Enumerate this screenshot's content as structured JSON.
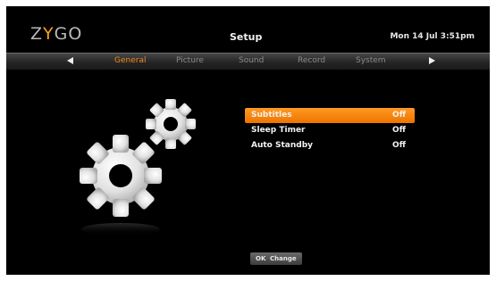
{
  "header": {
    "logo": {
      "prefix": "Z",
      "mid": "Y",
      "suffix": "GO",
      "accent_color": "#f7a21b"
    },
    "title": "Setup",
    "datetime": "Mon 14 Jul 3:51pm"
  },
  "tabs": {
    "items": [
      "General",
      "Picture",
      "Sound",
      "Record",
      "System"
    ],
    "active_color": "#f08a1c"
  },
  "menu": {
    "items": [
      {
        "label": "Subtitles",
        "value": "Off"
      },
      {
        "label": "Sleep Timer",
        "value": "Off"
      },
      {
        "label": "Auto Standby",
        "value": "Off"
      }
    ],
    "selected_color": "#f58a10"
  },
  "footer": {
    "ok_label": "OK",
    "action_label": "Change"
  }
}
